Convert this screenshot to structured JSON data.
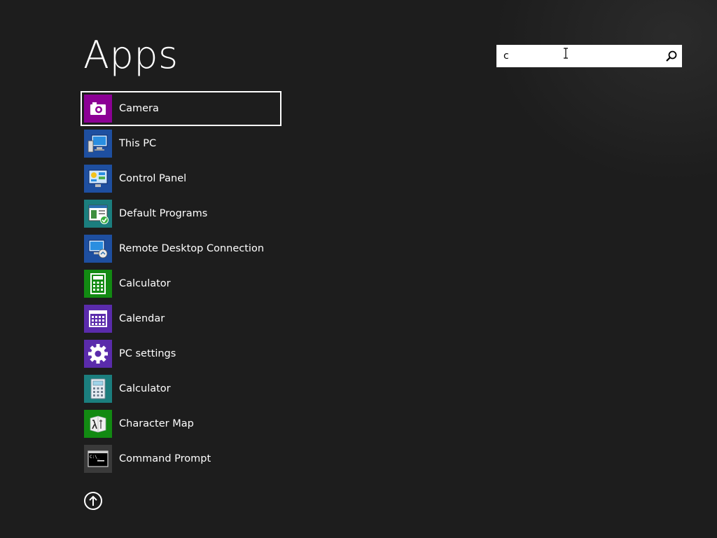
{
  "page": {
    "title": "Apps"
  },
  "search": {
    "value": "c",
    "icon": "search-icon"
  },
  "apps": [
    {
      "label": "Camera",
      "icon": "camera-icon",
      "tile_color": "#8c0095",
      "selected": true
    },
    {
      "label": "This PC",
      "icon": "computer-icon",
      "tile_color": "#1e4fa0"
    },
    {
      "label": "Control Panel",
      "icon": "control-panel-icon",
      "tile_color": "#1e4fa0"
    },
    {
      "label": "Default Programs",
      "icon": "default-programs-icon",
      "tile_color": "#1b7e7e"
    },
    {
      "label": "Remote Desktop Connection",
      "icon": "remote-desktop-icon",
      "tile_color": "#1e4fa0"
    },
    {
      "label": "Calculator",
      "icon": "calculator-icon",
      "tile_color": "#128a12"
    },
    {
      "label": "Calendar",
      "icon": "calendar-icon",
      "tile_color": "#5a2bab"
    },
    {
      "label": "PC settings",
      "icon": "gear-icon",
      "tile_color": "#5a2bab"
    },
    {
      "label": "Calculator",
      "icon": "desktop-calculator-icon",
      "tile_color": "#1b7e7e"
    },
    {
      "label": "Character Map",
      "icon": "character-map-icon",
      "tile_color": "#128a12"
    },
    {
      "label": "Command Prompt",
      "icon": "command-prompt-icon",
      "tile_color": "#3a3a3a"
    }
  ],
  "footer": {
    "scroll_up_icon": "arrow-up-icon"
  }
}
